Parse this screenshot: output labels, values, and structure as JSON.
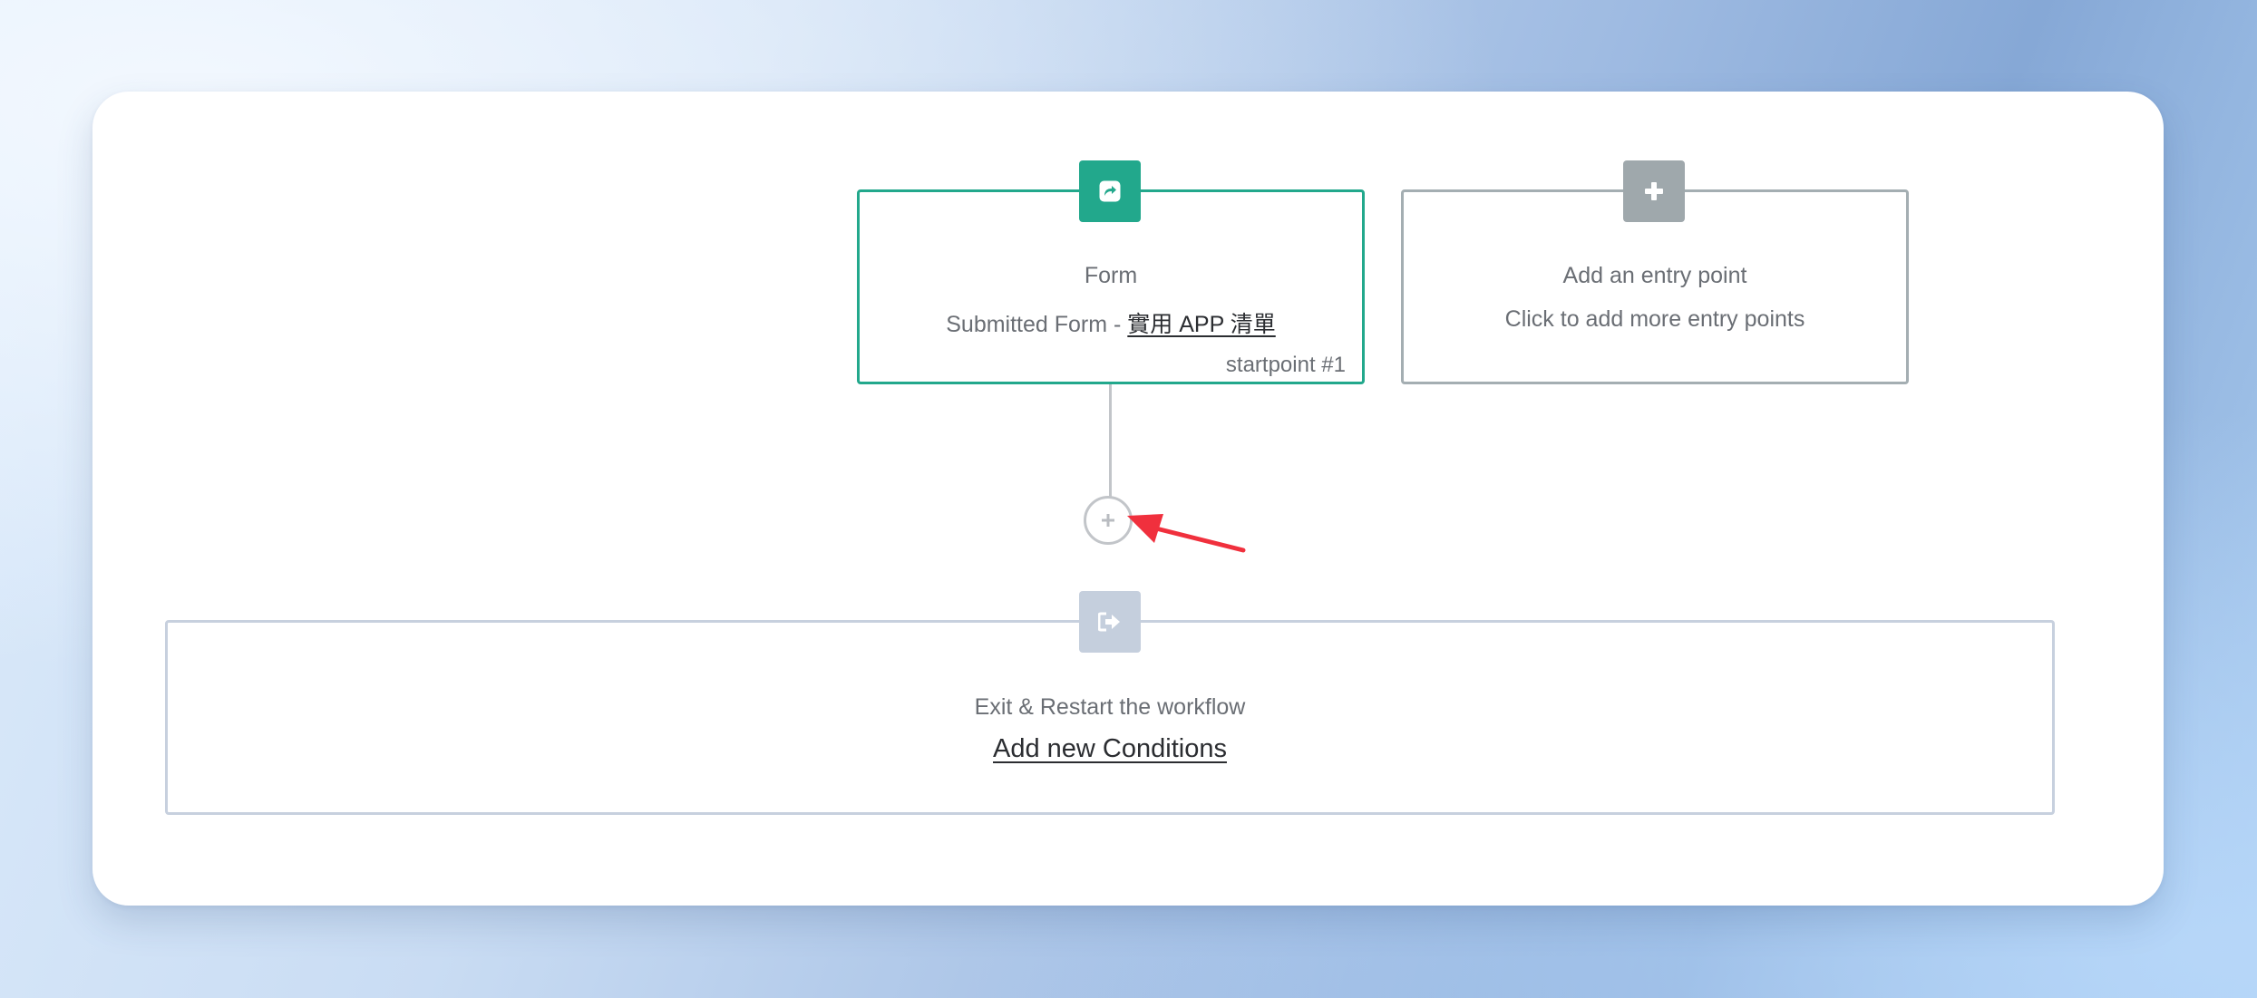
{
  "colors": {
    "form_accent": "#22a88c",
    "entry_accent": "#9fa8ac",
    "exit_accent": "#c5cfdd",
    "annotation_arrow": "#f0303d"
  },
  "form_node": {
    "icon": "share-arrow-icon",
    "title": "Form",
    "subtitle_prefix": "Submitted Form - ",
    "subtitle_link": "實用 APP 清單",
    "badge": "startpoint #1"
  },
  "entry_node": {
    "icon": "plus-icon",
    "title": "Add an entry point",
    "subtitle": "Click to add more entry points"
  },
  "add_step": {
    "icon": "plus-icon"
  },
  "exit_node": {
    "icon": "sign-out-icon",
    "title": "Exit & Restart the workflow",
    "link": "Add new Conditions"
  },
  "annotation": {
    "icon": "red-arrow-icon"
  }
}
